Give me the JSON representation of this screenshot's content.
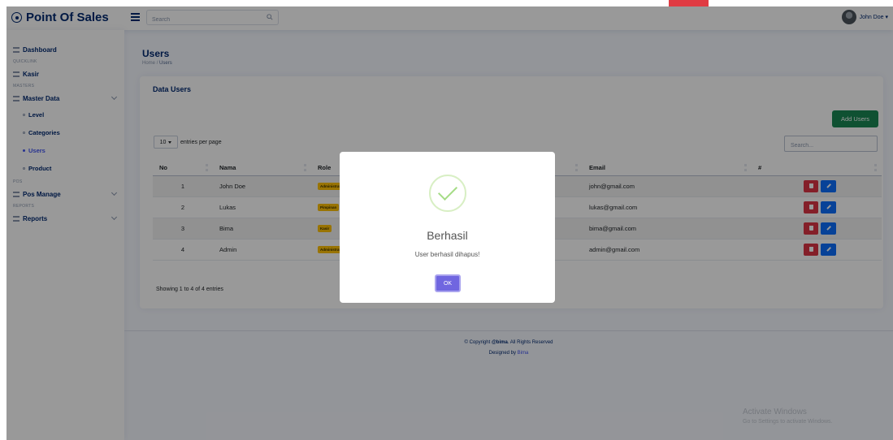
{
  "app": {
    "title": "Point Of Sales"
  },
  "header": {
    "search_placeholder": "Search",
    "user_name": "John Doe ▾"
  },
  "sidebar": {
    "dashboard": "Dashboard",
    "sections": {
      "quicklink": "QUICKLINK",
      "masters": "MASTERS",
      "pos": "POS",
      "reports": "REPORTS"
    },
    "kasir": "Kasir",
    "master_data": "Master Data",
    "sub_items": [
      "Level",
      "Categories",
      "Users",
      "Product"
    ],
    "active_sub_item": "Users",
    "pos_manage": "Pos Manage",
    "reports": "Reports"
  },
  "page": {
    "title": "Users",
    "breadcrumb": {
      "home": "Home",
      "separator": "/",
      "current": "Users"
    }
  },
  "card": {
    "title": "Data Users",
    "add_button": "Add Users",
    "per_page_value": "10",
    "per_page_label": "entries per page",
    "search_placeholder": "Search...",
    "columns": [
      "No",
      "Nama",
      "Role",
      "Email",
      "#"
    ],
    "rows": [
      {
        "no": "1",
        "nama": "John Doe",
        "role": "Administrator",
        "email": "john@gmail.com"
      },
      {
        "no": "2",
        "nama": "Lukas",
        "role": "Pimpinan",
        "email": "lukas@gmail.com"
      },
      {
        "no": "3",
        "nama": "Bima",
        "role": "Kasir",
        "email": "bima@gmail.com"
      },
      {
        "no": "4",
        "nama": "Admin",
        "role": "Administrator",
        "email": "admin@gmail.com"
      }
    ],
    "info": "Showing 1 to 4 of 4 entries"
  },
  "footer": {
    "copyright_prefix": "© Copyright ",
    "copyright_name": "@bima",
    "copyright_suffix": ". All Rights Reserved",
    "designed_prefix": "Designed by ",
    "designed_name": "Bima"
  },
  "watermark": {
    "line1": "Activate Windows",
    "line2": "Go to Settings to activate Windows."
  },
  "modal": {
    "title": "Berhasil",
    "text": "User berhasil dihapus!",
    "ok": "OK"
  },
  "colors": {
    "primary": "#012970",
    "accent": "#4154f1",
    "add_button": "#198754",
    "delete": "#dc3545",
    "edit": "#0d6efd",
    "badge": "#ffc107",
    "ok_button": "#7066e0",
    "success": "#a5dc86"
  }
}
